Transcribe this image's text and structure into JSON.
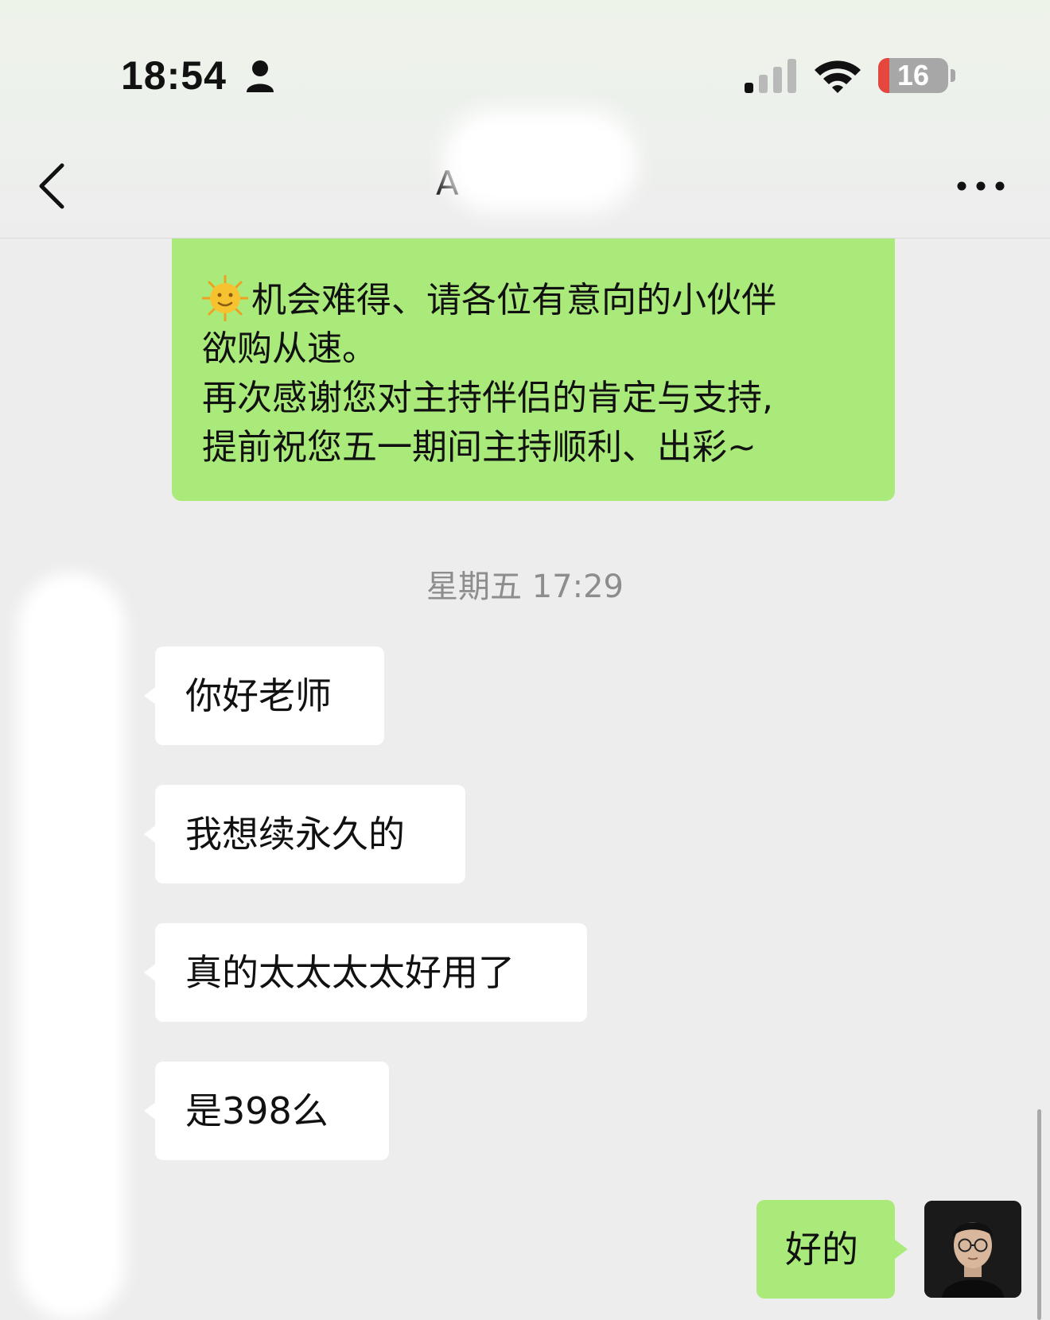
{
  "status_bar": {
    "time": "18:54",
    "battery": "16",
    "battery_level": 0.16,
    "icons": [
      "person-icon",
      "cellular-signal-icon",
      "wifi-icon",
      "battery-icon"
    ]
  },
  "header": {
    "title": "A",
    "back_icon": "chevron-left-icon",
    "more_icon": "more-dots-icon"
  },
  "messages": [
    {
      "side": "out",
      "lines": [
        "机会难得、请各位有意向的小伙伴",
        "欲购从速。",
        "再次感谢您对主持伴侣的肯定与支持,",
        "提前祝您五一期间主持顺利、出彩~"
      ],
      "emoji": "sun-with-face-icon"
    },
    {
      "side": "meta",
      "text": "星期五 17:29"
    },
    {
      "side": "in",
      "text": "你好老师"
    },
    {
      "side": "in",
      "text": "我想续永久的"
    },
    {
      "side": "in",
      "text": "真的太太太太好用了"
    },
    {
      "side": "in",
      "text": "是398么"
    },
    {
      "side": "out",
      "text": "好的"
    }
  ],
  "colors": {
    "background": "#ededed",
    "outgoing_bubble": "#a9ea7a",
    "incoming_bubble": "#ffffff",
    "timestamp": "#8d8d8d",
    "battery_low": "#e5463d"
  }
}
